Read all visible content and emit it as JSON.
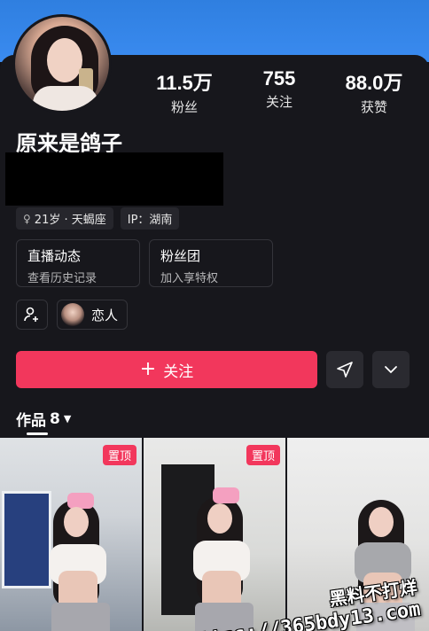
{
  "profile": {
    "username": "原来是鸽子",
    "stats": [
      {
        "value": "11.5万",
        "label": "粉丝"
      },
      {
        "value": "755",
        "label": "关注"
      },
      {
        "value": "88.0万",
        "label": "获赞"
      }
    ],
    "tags": [
      {
        "icon": "female-icon",
        "text": "21岁 · 天蝎座"
      },
      {
        "icon": "",
        "text": "IP：湖南"
      }
    ]
  },
  "cards": [
    {
      "title": "直播动态",
      "subtitle": "查看历史记录"
    },
    {
      "title": "粉丝团",
      "subtitle": "加入享特权"
    }
  ],
  "relation": {
    "label": "恋人"
  },
  "actions": {
    "follow_label": "关注"
  },
  "works": {
    "label": "作品",
    "count": "8"
  },
  "thumbnails": [
    {
      "badge": "置顶"
    },
    {
      "badge": "置顶"
    },
    {
      "badge": ""
    }
  ],
  "watermark": {
    "text": "黑料不打烊",
    "url": "https://365bdy13.com"
  },
  "colors": {
    "accent": "#f2375c",
    "banner": "#3a8bf0",
    "background": "#17171c"
  }
}
